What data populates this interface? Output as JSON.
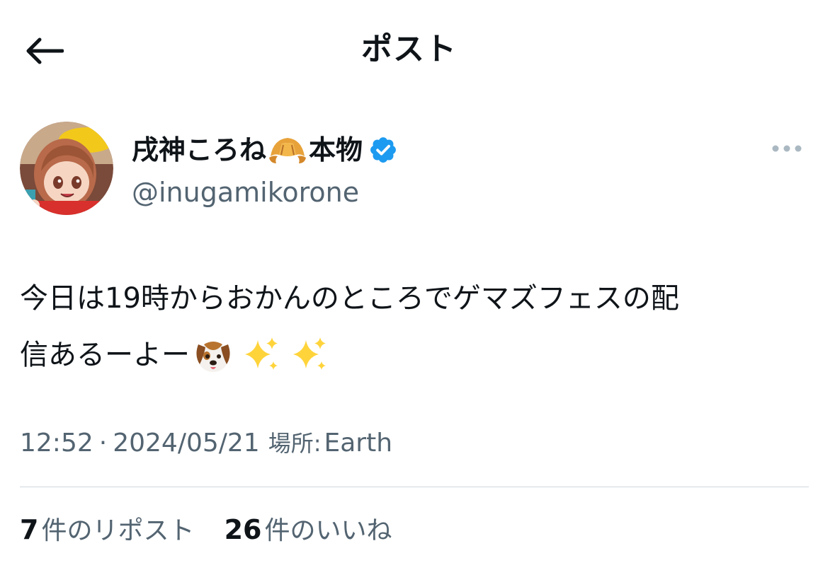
{
  "header": {
    "title": "ポスト",
    "back_icon": "arrow-left-icon"
  },
  "author": {
    "display_name_part1": "戌神ころね",
    "display_name_emoji": "croissant-icon",
    "display_name_part2": "本物",
    "verified_icon": "verified-badge-icon",
    "handle": "@inugamikorone"
  },
  "more_icon": "more-horizontal-icon",
  "tweet": {
    "line1": "今日は19時からおかんのところでゲマズフェスの配",
    "line2": "信あるーよー",
    "emojis": [
      "dog-face-icon",
      "sparkles-icon",
      "sparkles-icon"
    ]
  },
  "meta": {
    "time": "12:52",
    "separator": "·",
    "date": "2024/05/21",
    "location_label": "場所:",
    "location": "Earth"
  },
  "stats": {
    "reposts_count": "7",
    "reposts_label": "件のリポスト",
    "likes_count": "26",
    "likes_label": "件のいいね"
  },
  "colors": {
    "text_primary": "#0f1419",
    "text_secondary": "#536471",
    "verified_blue": "#1d9bf0",
    "divider": "#cfd9de",
    "more_dots": "#aab8c2"
  }
}
